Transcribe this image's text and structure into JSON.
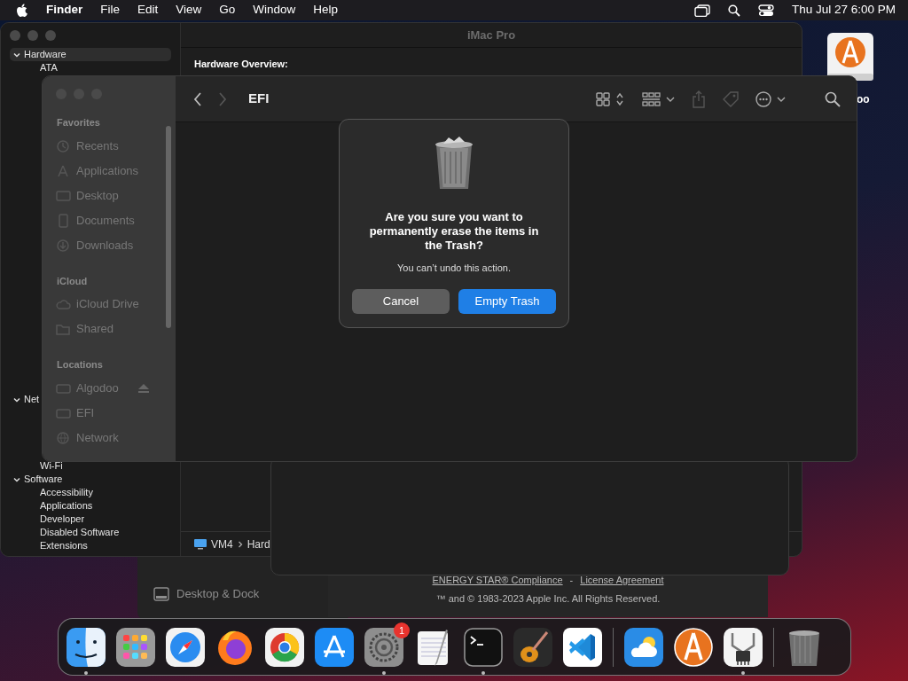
{
  "menu_bar": {
    "app": "Finder",
    "menus": [
      "File",
      "Edit",
      "View",
      "Go",
      "Window",
      "Help"
    ],
    "clock": "Thu Jul 27  6:00 PM"
  },
  "desktop_icons": [
    {
      "label": "oo"
    }
  ],
  "system_information": {
    "title": "iMac Pro",
    "heading": "Hardware Overview:",
    "path": [
      "VM4",
      "Hard"
    ],
    "sidebar": [
      {
        "label": "Hardware",
        "expanded": true,
        "selected": true,
        "children": [
          {
            "label": "ATA"
          }
        ]
      },
      {
        "label": "Net",
        "expanded": true,
        "selected": false,
        "children": [
          {
            "label": "Wi-Fi"
          }
        ]
      },
      {
        "label": "Software",
        "expanded": true,
        "selected": false,
        "children": [
          {
            "label": "Accessibility"
          },
          {
            "label": "Applications"
          },
          {
            "label": "Developer"
          },
          {
            "label": "Disabled Software"
          },
          {
            "label": "Extensions"
          }
        ]
      }
    ]
  },
  "system_settings": {
    "items": [
      {
        "label": "Desktop & Dock"
      }
    ]
  },
  "about": {
    "links": [
      "ENERGY STAR® Compliance",
      "License Agreement"
    ],
    "separator": "-",
    "copyright": "™ and © 1983-2023 Apple Inc. All Rights Reserved."
  },
  "finder": {
    "title": "EFI",
    "sidebar": [
      {
        "heading": "Favorites",
        "items": [
          {
            "label": "Recents",
            "kind": "clock"
          },
          {
            "label": "Applications",
            "kind": "apps"
          },
          {
            "label": "Desktop",
            "kind": "desktop"
          },
          {
            "label": "Documents",
            "kind": "document"
          },
          {
            "label": "Downloads",
            "kind": "download"
          }
        ]
      },
      {
        "heading": "iCloud",
        "items": [
          {
            "label": "iCloud Drive",
            "kind": "cloud"
          },
          {
            "label": "Shared",
            "kind": "folder"
          }
        ]
      },
      {
        "heading": "Locations",
        "items": [
          {
            "label": "Algodoo",
            "kind": "drive",
            "ejectable": true
          },
          {
            "label": "EFI",
            "kind": "drive",
            "ejectable": false
          },
          {
            "label": "Network",
            "kind": "globe",
            "ejectable": false
          }
        ]
      }
    ]
  },
  "dialog": {
    "title": "Are you sure you want to permanently erase the items in the Trash?",
    "message": "You can’t undo this action.",
    "buttons": [
      {
        "label": "Cancel",
        "default": false
      },
      {
        "label": "Empty Trash",
        "default": true
      }
    ]
  },
  "dock": {
    "apps": [
      {
        "kind": "finder",
        "running": true
      },
      {
        "kind": "launchpad",
        "running": false
      },
      {
        "kind": "safari",
        "running": false
      },
      {
        "kind": "firefox",
        "running": false
      },
      {
        "kind": "chrome",
        "running": false
      },
      {
        "kind": "appstore",
        "running": false
      },
      {
        "kind": "settings",
        "running": true,
        "badge": "1"
      },
      {
        "kind": "textedit",
        "running": false
      },
      {
        "kind": "terminal",
        "running": true
      },
      {
        "kind": "garageband",
        "running": false
      },
      {
        "kind": "vscode",
        "running": false,
        "separator_after": true
      },
      {
        "kind": "weather",
        "running": false
      },
      {
        "kind": "algodoo",
        "running": false
      },
      {
        "kind": "caliper",
        "running": true,
        "separator_after": true
      },
      {
        "kind": "trash",
        "running": false
      }
    ]
  }
}
